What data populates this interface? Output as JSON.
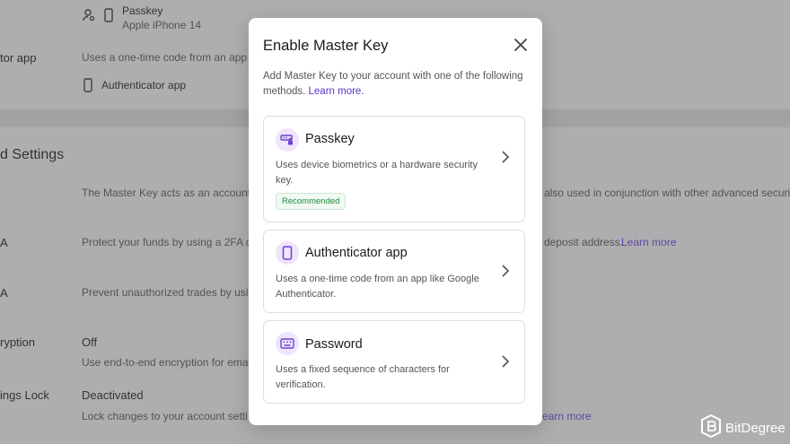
{
  "background": {
    "passkey_label": "Passkey",
    "passkey_device": "Apple iPhone 14",
    "auth_row_label": "tor app",
    "auth_row_desc": "Uses a one-time code from an app l",
    "auth_row_item": "Authenticator app",
    "section_title": "d Settings",
    "master_desc_left": "The Master Key acts as an account",
    "master_desc_right": "also used in conjunction with other advanced securi",
    "fa_label": "A",
    "fa_desc_left": "Protect your funds by using a 2FA c",
    "fa_desc_right": "deposit address.",
    "fa_learn": "Learn more",
    "trade_label": "A",
    "trade_desc": "Prevent unauthorized trades by usi",
    "enc_label": "ryption",
    "enc_value": "Off",
    "enc_desc": "Use end-to-end encryption for ema",
    "lock_label": "ings Lock",
    "lock_value": "Deactivated",
    "lock_desc": "Lock changes to your account setti",
    "lock_learn": "earn more"
  },
  "modal": {
    "title": "Enable Master Key",
    "desc": "Add Master Key to your account with one of the following methods.",
    "learn_more": "Learn more.",
    "options": [
      {
        "title": "Passkey",
        "desc": "Uses device biometrics or a hardware security key.",
        "badge": "Recommended",
        "icon": "passkey-icon"
      },
      {
        "title": "Authenticator app",
        "desc": "Uses a one-time code from an app like Google Authenticator.",
        "icon": "phone-icon"
      },
      {
        "title": "Password",
        "desc": "Uses a fixed sequence of characters for verification.",
        "icon": "keyboard-icon"
      }
    ]
  },
  "watermark": "BitDegree",
  "colors": {
    "accent": "#6b3fd6",
    "badge_green": "#1f8a3a",
    "icon_bg": "#eee5fb"
  }
}
